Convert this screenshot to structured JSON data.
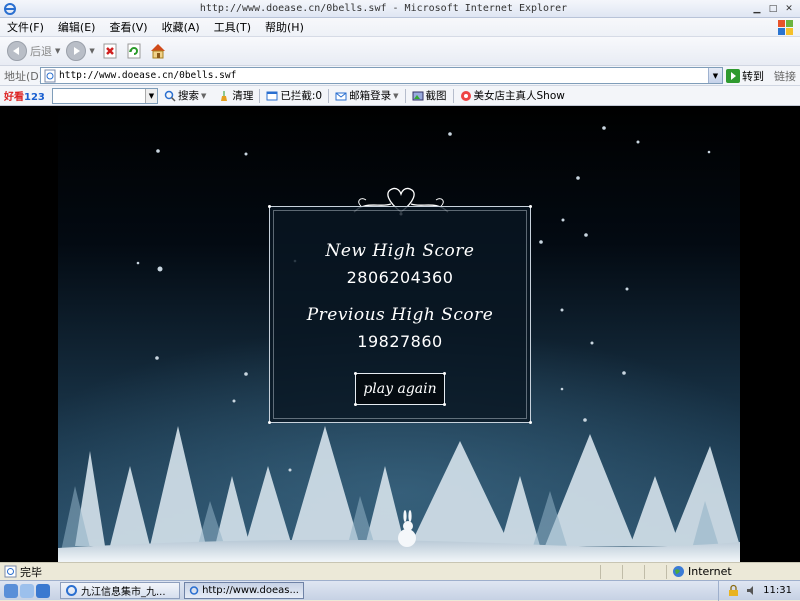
{
  "window": {
    "title": "http://www.doease.cn/0bells.swf - Microsoft Internet Explorer",
    "controls": [
      "minimize",
      "maximize",
      "close"
    ]
  },
  "menu": [
    "文件(F)",
    "编辑(E)",
    "查看(V)",
    "收藏(A)",
    "工具(T)",
    "帮助(H)"
  ],
  "toolbar": {
    "back_label": "后退",
    "icons": [
      "back-icon",
      "forward-icon",
      "stop-icon",
      "refresh-icon",
      "home-icon"
    ]
  },
  "address_bar": {
    "label": "地址(D)",
    "url": "http://www.doease.cn/0bells.swf",
    "go_label": "转到",
    "links_label": "链接"
  },
  "custom_toolbar": {
    "brand_part1": "好看",
    "brand_part2": "123",
    "search_value": "",
    "items": [
      "搜索",
      "清理",
      "已拦截:0",
      "邮箱登录",
      "截图",
      "美女店主真人Show"
    ]
  },
  "game": {
    "new_high_label": "New High Score",
    "new_high_value": "2806204360",
    "prev_high_label": "Previous High Score",
    "prev_high_value": "19827860",
    "play_again_label": "play again"
  },
  "status": {
    "text": "完毕",
    "zone": "Internet"
  },
  "taskbar": {
    "tasks": [
      "九江信息集市_九...",
      "http://www.doeas..."
    ],
    "clock": "11:31"
  },
  "colors": {
    "sky_top": "#000000",
    "sky_bottom": "#2a4f68",
    "snow": "#dfe8ef",
    "go_green": "#2f9a2f"
  }
}
